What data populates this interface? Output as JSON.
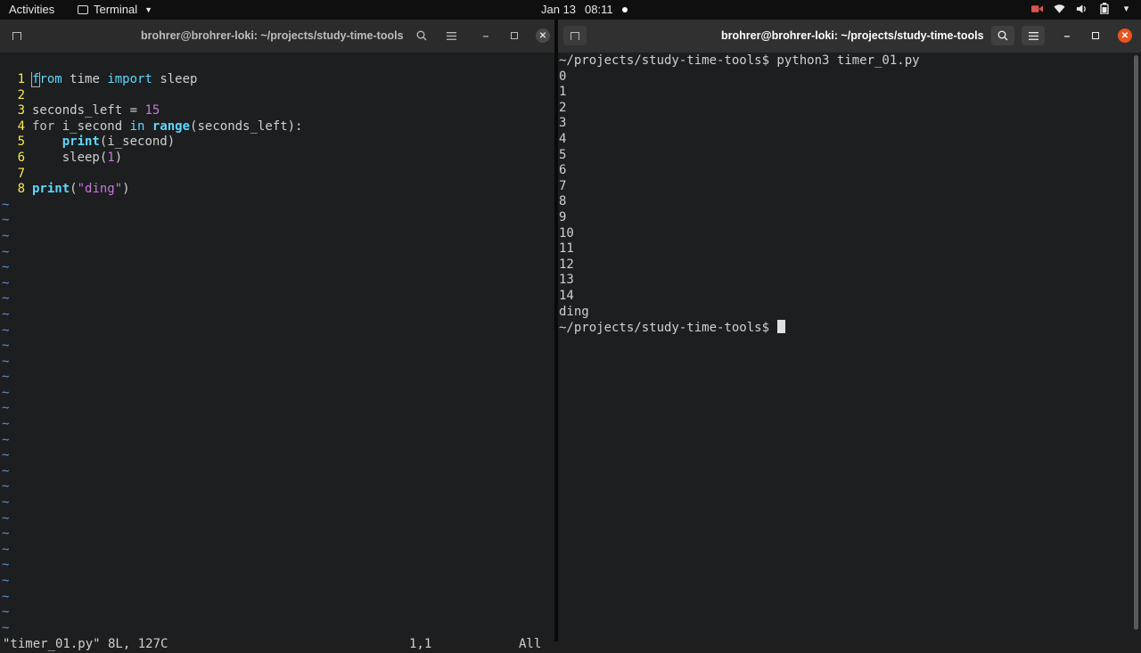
{
  "topbar": {
    "activities": "Activities",
    "app_name": "Terminal",
    "date": "Jan 13",
    "time": "08:11",
    "tray_icons": [
      "camera-icon",
      "wifi-icon",
      "volume-icon",
      "battery-icon",
      "power-menu-icon"
    ]
  },
  "left_window": {
    "title": "brohrer@brohrer-loki: ~/projects/study-time-tools"
  },
  "right_window": {
    "title": "brohrer@brohrer-loki: ~/projects/study-time-tools"
  },
  "vim": {
    "line_numbers": [
      "1",
      "2",
      "3",
      "4",
      "5",
      "6",
      "7",
      "8"
    ],
    "code": {
      "l1_from": "from",
      "l1_rest": " time ",
      "l1_import": "import",
      "l1_sleep": " sleep",
      "l3_a": "seconds_left = ",
      "l3_num": "15",
      "l4_for": "for",
      "l4_mid": " i_second ",
      "l4_in": "in",
      "l4_range": "range",
      "l4_end": "(seconds_left):",
      "l5_indent": "    ",
      "l5_print": "print",
      "l5_end": "(i_second)",
      "l6_a": "    sleep(",
      "l6_num": "1",
      "l6_end": ")",
      "l8_print": "print",
      "l8_open": "(",
      "l8_str": "\"ding\"",
      "l8_close": ")"
    },
    "tilde": "~",
    "status_message": "\"timer_01.py\" 8L, 127C",
    "cursor_position": "1,1",
    "scroll_position": "All"
  },
  "terminal": {
    "lines": [
      "~/projects/study-time-tools$ python3 timer_01.py",
      "0",
      "1",
      "2",
      "3",
      "4",
      "5",
      "6",
      "7",
      "8",
      "9",
      "10",
      "11",
      "12",
      "13",
      "14",
      "ding"
    ],
    "prompt": "~/projects/study-time-tools$ "
  }
}
